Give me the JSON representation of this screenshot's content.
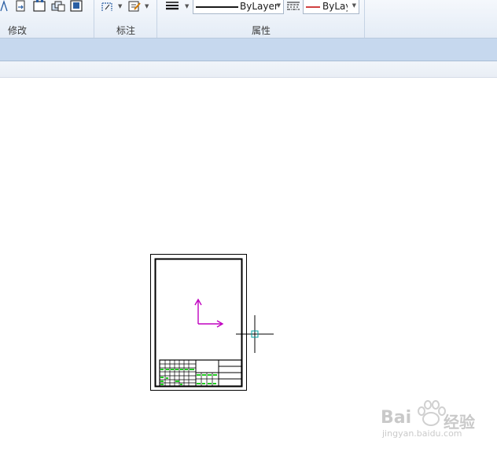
{
  "ribbon": {
    "panels": {
      "modify": "修改",
      "dimension": "标注",
      "properties": "属性"
    },
    "linetype_dropdown": "ByLayer",
    "color_dropdown": "ByLay"
  },
  "watermark": {
    "brand": "Bai",
    "brand_suffix": "经验",
    "url": "jingyan.baidu.com"
  },
  "colors": {
    "ucs_icon": "#c000c0",
    "title_block_fill": "#22cc22",
    "crosshair": "#000000",
    "pickbox": "#00a0a0",
    "color_swatch": "#c00000"
  },
  "icons": [
    "fillet-icon",
    "stretch-icon",
    "rectangle-icon",
    "array-icon",
    "copy-icon",
    "dimension-icon",
    "edit-icon",
    "lineweight-icon",
    "linetype-icon"
  ]
}
